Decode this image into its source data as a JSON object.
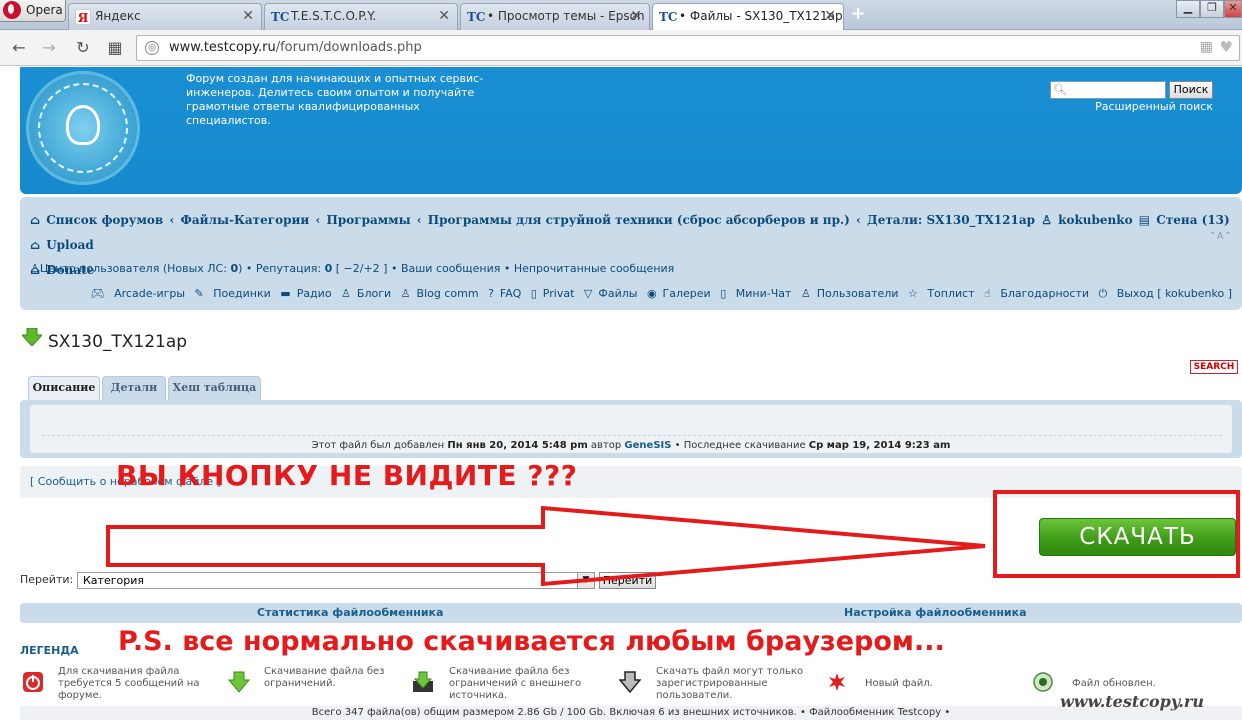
{
  "browser": {
    "menu_label": "Opera",
    "tabs": [
      {
        "label": "Яндекс",
        "favicon": "Я"
      },
      {
        "label": "T.E.S.T.C.O.P.Y.",
        "favicon": "TC"
      },
      {
        "label": "• Просмотр темы - Epson",
        "favicon": "TC"
      },
      {
        "label": "• Файлы - SX130_TX121ap",
        "favicon": "TC"
      }
    ],
    "new_tab": "+",
    "url_host": "www.testcopy.ru",
    "url_path": "/forum/downloads.php"
  },
  "header": {
    "description": "Форум создан для начинающих и опытных сервис-инженеров. Делитесь своим опытом и получайте грамотные ответы квалифицированных специалистов.",
    "search_button": "Поиск",
    "advanced_search": "Расширенный поиск"
  },
  "nav": {
    "breadcrumb_1": "Список форумов",
    "breadcrumb_2": "Файлы-Категории",
    "breadcrumb_3": "Программы",
    "breadcrumb_4": "Программы для струйной техники (сброс абсорберов и пр.)",
    "breadcrumb_5": "Детали: SX130_TX121ap",
    "user": "kokubenko",
    "wall": "Стена (13)",
    "upload": "Upload",
    "donate": "Donate",
    "collapse": "⌃A⌃",
    "user_center": "Центр пользователя (Новых ЛС: ",
    "pm_count": "0",
    "reputation_label": ") • Репутация: ",
    "reputation_value": "0",
    "reputation_range": " [ −2/+2 ] • ",
    "your_posts": "Ваши сообщения",
    "sep": " • ",
    "unread": "Непрочитанные сообщения",
    "menu": {
      "arcade": "Arcade-игры",
      "duels": "Поединки",
      "radio": "Радио",
      "blogs": "Блоги",
      "blog_comm": "Blog comm",
      "faq": "FAQ",
      "privat": "Privat",
      "files": "Файлы",
      "gallery": "Галереи",
      "minichat": "Мини-Чат",
      "users": "Пользователи",
      "toplist": "Топлист",
      "thanks": "Благодарности",
      "logout": "Выход [ kokubenko ]"
    }
  },
  "content": {
    "title": "SX130_TX121ap",
    "search_badge": "SEARCH",
    "tabs": [
      "Описание",
      "Детали",
      "Хеш таблица"
    ],
    "added_prefix": "Этот файл был добавлен ",
    "added_date": "Пн янв 20, 2014 5:48 pm",
    "author_prefix": " автор ",
    "author": "GeneSIS",
    "last_prefix": " • Последнее скачивание ",
    "last_date": "Ср мар 19, 2014 9:23 am",
    "report_link": "[ Сообщить о нерабочем файле ]",
    "download_button": "СКАЧАТЬ",
    "goto_label": "Перейти:",
    "goto_value": "Категория",
    "goto_button": "Перейти",
    "stats": "Статистика файлообменника",
    "settings": "Настройка файлообменника"
  },
  "legend": {
    "title": "ЛЕГЕНДА",
    "items": [
      "Для скачивания файла требуется 5 сообщений на форуме.",
      "Скачивание файла без ограничений.",
      "Скачивание файла без ограничений с внешнего источника.",
      "Скачать файл могут только зарегистрированные пользователи.",
      "Новый файл.",
      "Файл обновлен."
    ]
  },
  "footer": {
    "summary": "Всего 347 файла(ов) общим размером 2.86 Gb / 100 Gb. Включая 6 из внешних источников. • Файлообменник Testcopy •"
  },
  "watermark": "www.testcopy.ru",
  "annotations": {
    "top": "ВЫ КНОПКУ НЕ ВИДИТЕ ???",
    "bottom": "P.S. все нормально скачивается любым браузером..."
  },
  "colors": {
    "header_blue": "#1a8fd3",
    "panel": "#cadcea",
    "link": "#0b4a7c",
    "download_green": "#3d9a16",
    "annotation_red": "#e51a1a"
  }
}
